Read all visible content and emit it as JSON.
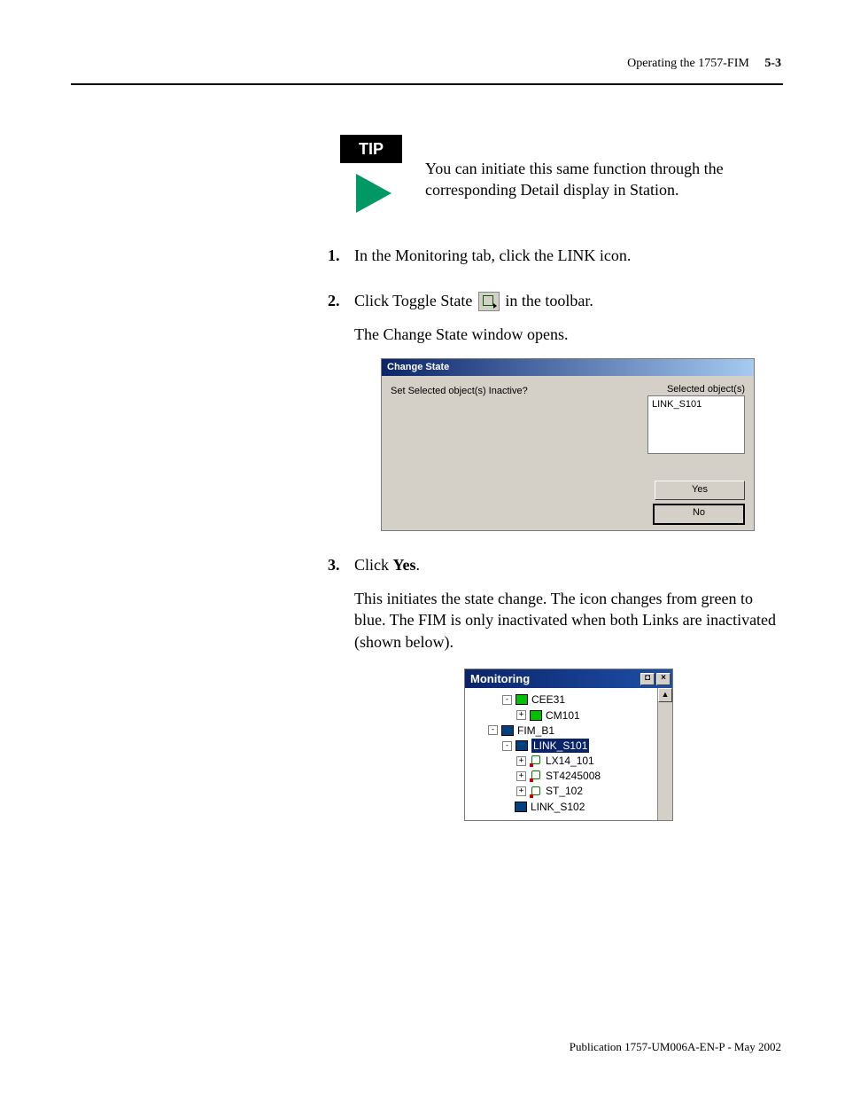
{
  "header": {
    "section_title": "Operating the 1757-FIM",
    "page_number": "5-3"
  },
  "tip": {
    "badge": "TIP",
    "text": "You can initiate this same function through the corresponding Detail display in Station."
  },
  "steps": {
    "s1": "In the Monitoring tab, click the LINK icon.",
    "s2_a": "Click Toggle State",
    "s2_b": "in the toolbar.",
    "s2_result": "The Change State window opens.",
    "s3_a": "Click ",
    "s3_bold": "Yes",
    "s3_b": ".",
    "s3_result": "This initiates the state change. The icon changes from green to blue. The FIM is only inactivated when both Links are inactivated (shown below)."
  },
  "dialog": {
    "title": "Change State",
    "question": "Set Selected object(s) Inactive?",
    "selected_label": "Selected object(s)",
    "selected_item": "LINK_S101",
    "yes": "Yes",
    "no": "No"
  },
  "monitoring": {
    "title": "Monitoring",
    "rows": {
      "r0": "CEE31",
      "r1": "CM101",
      "r2": "FIM_B1",
      "r3": "LINK_S101",
      "r4": "LX14_101",
      "r5": "ST4245008",
      "r6": "ST_102",
      "r7": "LINK_S102"
    }
  },
  "footer": "Publication 1757-UM006A-EN-P - May 2002"
}
